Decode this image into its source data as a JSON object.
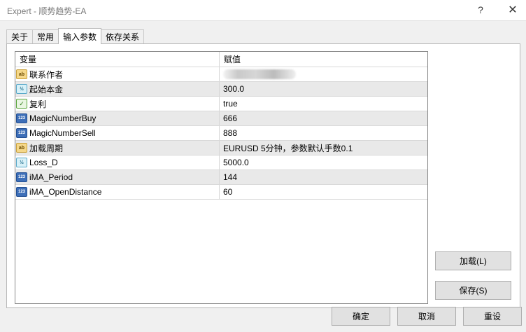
{
  "window": {
    "title": "Expert - 顺势趋势-EA",
    "help": "?",
    "close": "✕"
  },
  "tabs": [
    {
      "label": "关于",
      "active": false
    },
    {
      "label": "常用",
      "active": false
    },
    {
      "label": "输入参数",
      "active": true
    },
    {
      "label": "依存关系",
      "active": false
    }
  ],
  "grid": {
    "col_variable": "变量",
    "col_value": "赋值",
    "rows": [
      {
        "icon": "ab",
        "name": "联系作者",
        "value": ""
      },
      {
        "icon": "½",
        "name": "起始本金",
        "value": "300.0"
      },
      {
        "icon": "✓",
        "name": "复利",
        "value": "true"
      },
      {
        "icon": "123",
        "name": "MagicNumberBuy",
        "value": "666"
      },
      {
        "icon": "123",
        "name": "MagicNumberSell",
        "value": "888"
      },
      {
        "icon": "ab",
        "name": "加载周期",
        "value": "EURUSD 5分钟，参数默认手数0.1"
      },
      {
        "icon": "½",
        "name": "Loss_D",
        "value": "5000.0"
      },
      {
        "icon": "123",
        "name": "iMA_Period",
        "value": "144"
      },
      {
        "icon": "123",
        "name": "iMA_OpenDistance",
        "value": "60"
      }
    ]
  },
  "buttons": {
    "load": "加载(L)",
    "save": "保存(S)",
    "ok": "确定",
    "cancel": "取消",
    "reset": "重设"
  }
}
